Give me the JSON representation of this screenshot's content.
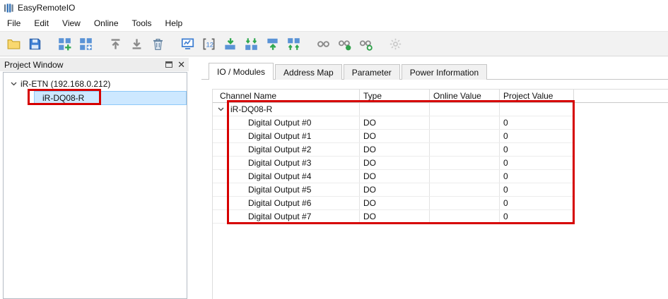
{
  "window": {
    "title": "EasyRemoteIO"
  },
  "menubar": {
    "items": [
      "File",
      "Edit",
      "View",
      "Online",
      "Tools",
      "Help"
    ]
  },
  "toolbar": {
    "groups": [
      [
        {
          "name": "open-project"
        },
        {
          "name": "save-project"
        }
      ],
      [
        {
          "name": "add-device"
        },
        {
          "name": "add-module"
        }
      ],
      [
        {
          "name": "move-up"
        },
        {
          "name": "move-down"
        },
        {
          "name": "delete"
        }
      ],
      [
        {
          "name": "online-monitor"
        },
        {
          "name": "address-overview"
        },
        {
          "name": "write-device"
        },
        {
          "name": "write-all-devices"
        },
        {
          "name": "read-device"
        },
        {
          "name": "read-all-devices"
        }
      ],
      [
        {
          "name": "scan-network"
        },
        {
          "name": "connect"
        },
        {
          "name": "disconnect"
        }
      ],
      [
        {
          "name": "gateway-settings",
          "disabled": true
        }
      ]
    ]
  },
  "project_window": {
    "title": "Project Window",
    "tree": {
      "root_label": "iR-ETN (192.168.0.212)",
      "child_label": "iR-DQ08-R"
    }
  },
  "tabs": {
    "items": [
      "IO / Modules",
      "Address Map",
      "Parameter",
      "Power Information"
    ],
    "active": 0
  },
  "module_table": {
    "columns": [
      "Channel Name",
      "Type",
      "Online Value",
      "Project Value"
    ],
    "group": {
      "name": "iR-DQ08-R"
    },
    "rows": [
      {
        "name": "Digital Output #0",
        "type": "DO",
        "online_value": "",
        "project_value": "0"
      },
      {
        "name": "Digital Output #1",
        "type": "DO",
        "online_value": "",
        "project_value": "0"
      },
      {
        "name": "Digital Output #2",
        "type": "DO",
        "online_value": "",
        "project_value": "0"
      },
      {
        "name": "Digital Output #3",
        "type": "DO",
        "online_value": "",
        "project_value": "0"
      },
      {
        "name": "Digital Output #4",
        "type": "DO",
        "online_value": "",
        "project_value": "0"
      },
      {
        "name": "Digital Output #5",
        "type": "DO",
        "online_value": "",
        "project_value": "0"
      },
      {
        "name": "Digital Output #6",
        "type": "DO",
        "online_value": "",
        "project_value": "0"
      },
      {
        "name": "Digital Output #7",
        "type": "DO",
        "online_value": "",
        "project_value": "0"
      }
    ]
  },
  "colors": {
    "annotation_red": "#d60000",
    "selection_bg": "#cde8ff",
    "selection_border": "#8ec8f8",
    "accent_blue": "#3f7fd2"
  }
}
